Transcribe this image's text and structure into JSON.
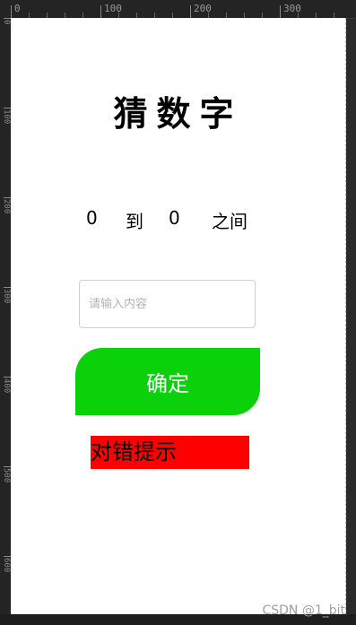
{
  "ruler": {
    "top_labels": [
      "0",
      "100",
      "200",
      "300"
    ],
    "left_labels": [
      "0",
      "100",
      "200",
      "300",
      "400",
      "500",
      "600"
    ]
  },
  "game": {
    "title": "猜数字",
    "range": {
      "min": "0",
      "to": "到",
      "max": "0",
      "between": "之间"
    },
    "input": {
      "placeholder": "请输入内容",
      "value": ""
    },
    "confirm_label": "确定",
    "hint_label": "对错提示",
    "colors": {
      "confirm": "#0ad10a",
      "hint": "#ff0000"
    }
  },
  "watermark": "CSDN @1_bit"
}
